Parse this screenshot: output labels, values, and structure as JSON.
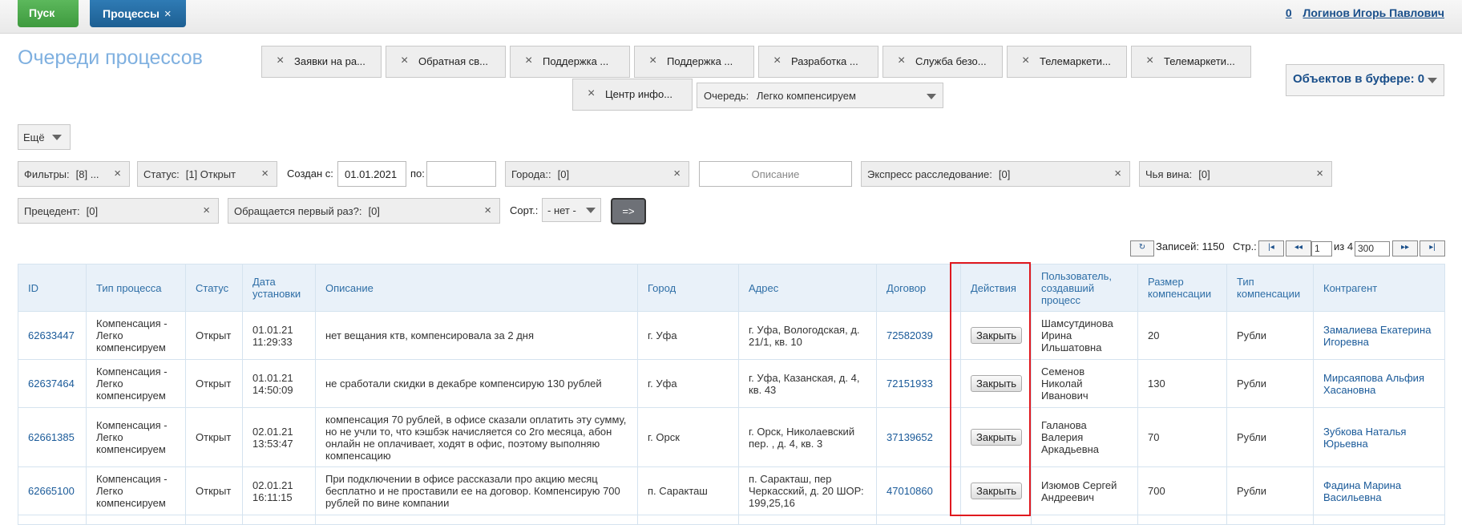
{
  "topbar": {
    "start_label": "Пуск",
    "process_tab_label": "Процессы",
    "process_tab_close": "×",
    "user_count": "0",
    "user_name": "Логинов Игорь Павлович"
  },
  "page_title": "Очереди процессов",
  "queue_tabs": [
    {
      "label": "Заявки на ра..."
    },
    {
      "label": "Обратная св..."
    },
    {
      "label": "Поддержка ..."
    },
    {
      "label": "Поддержка ..."
    },
    {
      "label": "Разработка ..."
    },
    {
      "label": "Служба безо..."
    },
    {
      "label": "Телемаркети..."
    },
    {
      "label": "Телемаркети..."
    },
    {
      "label": "Центр инфо..."
    }
  ],
  "queue_select": {
    "label": "Очередь:",
    "value": "Легко компенсируем"
  },
  "buffer": {
    "label": "Объектов в буфере:",
    "count": "0"
  },
  "more_label": "Ещё",
  "filters": {
    "filters": {
      "label": "Фильтры:",
      "value": "[8] ..."
    },
    "status": {
      "label": "Статус:",
      "value": "[1] Открыт"
    },
    "created_from_label": "Создан с:",
    "created_from": "01.01.2021",
    "created_to_label": "по:",
    "created_to": "",
    "cities": {
      "label": "Города::",
      "value": "[0]"
    },
    "description_placeholder": "Описание",
    "express": {
      "label": "Экспресс расследование:",
      "value": "[0]"
    },
    "blame": {
      "label": "Чья вина:",
      "value": "[0]"
    },
    "precedent": {
      "label": "Прецедент:",
      "value": "[0]"
    },
    "first_time": {
      "label": "Обращается первый раз?:",
      "value": "[0]"
    },
    "sort_label": "Сорт.:",
    "sort_value": "- нет -",
    "go_label": "=>"
  },
  "pager": {
    "refresh_icon": "↻",
    "records_label": "Записей: 1150",
    "page_label": "Стр.:",
    "page_value": "1",
    "of_label": "из 4",
    "per_page": "300",
    "first": "|◂",
    "prev": "◂◂",
    "next": "▸▸",
    "last": "▸|"
  },
  "table": {
    "headers": [
      "ID",
      "Тип процесса",
      "Статус",
      "Дата установки",
      "Описание",
      "Город",
      "Адрес",
      "Договор",
      "Действия",
      "Пользователь, создавший процесс",
      "Размер компенсации",
      "Тип компенсации",
      "Контрагент"
    ],
    "rows": [
      {
        "id": "62633447",
        "type": "Компенсация - Легко компенсируем",
        "status": "Открыт",
        "date": "01.01.21 11:29:33",
        "desc": "нет вещания ктв, компенсировала за 2 дня",
        "city": "г. Уфа",
        "address": "г. Уфа, Вологодская, д. 21/1, кв. 10",
        "contract": "72582039",
        "action": "Закрыть",
        "user": "Шамсутдинова Ирина Ильшатовна",
        "amount": "20",
        "comp_type": "Рубли",
        "partner": "Замалиева Екатерина Игоревна"
      },
      {
        "id": "62637464",
        "type": "Компенсация - Легко компенсируем",
        "status": "Открыт",
        "date": "01.01.21 14:50:09",
        "desc": "не сработали скидки в декабре компенсирую 130 рублей",
        "city": "г. Уфа",
        "address": "г. Уфа, Казанская, д. 4, кв. 43",
        "contract": "72151933",
        "action": "Закрыть",
        "user": "Семенов Николай Иванович",
        "amount": "130",
        "comp_type": "Рубли",
        "partner": "Мирсаяпова Альфия Хасановна"
      },
      {
        "id": "62661385",
        "type": "Компенсация - Легко компенсируем",
        "status": "Открыт",
        "date": "02.01.21 13:53:47",
        "desc": "компенсация 70 рублей, в офисе сказали оплатить эту сумму, но не учли то, что кэшбэк начисляется со 2го месяца, абон онлайн не оплачивает, ходят в офис, поэтому выполняю компенсацию",
        "city": "г. Орск",
        "address": "г. Орск, Николаевский пер. , д. 4, кв. 3",
        "contract": "37139652",
        "action": "Закрыть",
        "user": "Галанова Валерия Аркадьевна",
        "amount": "70",
        "comp_type": "Рубли",
        "partner": "Зубкова Наталья Юрьевна"
      },
      {
        "id": "62665100",
        "type": "Компенсация - Легко компенсируем",
        "status": "Открыт",
        "date": "02.01.21 16:11:15",
        "desc": "При подключении в офисе рассказали про акцию месяц бесплатно и не проставили ее на договор. Компенсирую 700 рублей по вине компании",
        "city": "п. Саракташ",
        "address": "п. Саракташ, пер Черкасский, д. 20 ШОР: 199,25,16",
        "contract": "47010860",
        "action": "Закрыть",
        "user": "Изюмов Сергей Андреевич",
        "amount": "700",
        "comp_type": "Рубли",
        "partner": "Фадина Марина Васильевна"
      }
    ]
  },
  "colors": {
    "accent": "#2e6ea6",
    "highlight": "#e0191f",
    "start": "#4cae4c",
    "process_tab": "#286090"
  }
}
